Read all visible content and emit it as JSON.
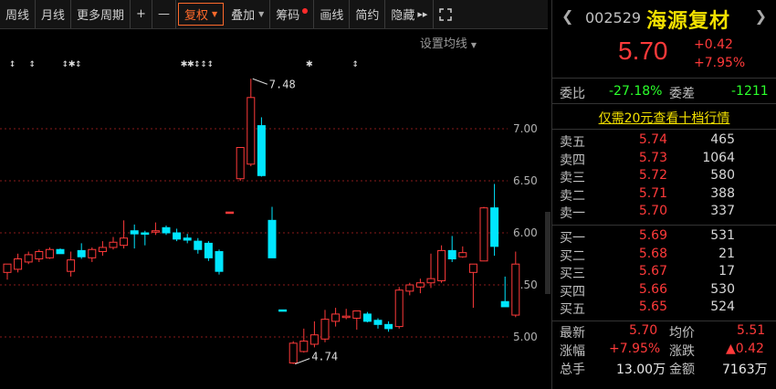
{
  "toolbar": {
    "items": [
      {
        "label": "周线",
        "dropdown": false
      },
      {
        "label": "月线",
        "dropdown": false
      },
      {
        "label": "更多周期",
        "dropdown": false
      },
      {
        "label": "+",
        "dropdown": false
      },
      {
        "label": "—",
        "dropdown": false
      },
      {
        "label": "复权",
        "dropdown": true,
        "active": true
      },
      {
        "label": "叠加",
        "dropdown": true
      },
      {
        "label": "筹码",
        "dropdown": false,
        "red_dot": true
      },
      {
        "label": "画线",
        "dropdown": false
      },
      {
        "label": "简约",
        "dropdown": false
      },
      {
        "label": "隐藏",
        "dropdown": false,
        "suffix": "▸▸"
      }
    ],
    "expand_icon": "expand-icon"
  },
  "chart": {
    "ma_setting_label": "设置均线",
    "y_ticks": [
      "7.00",
      "6.50",
      "6.00",
      "5.50",
      "5.00"
    ],
    "high_label": "7.48",
    "low_label": "4.74",
    "colors": {
      "up": "#ff3a3a",
      "down": "#00e6ff",
      "grid": "#8a1a1a",
      "flat": "#00e6ff"
    }
  },
  "chart_data": {
    "type": "candlestick",
    "ylim": [
      4.7,
      7.6
    ],
    "y_ticks": [
      5.0,
      5.5,
      6.0,
      6.5,
      7.0
    ],
    "candles": [
      {
        "o": 5.62,
        "h": 5.7,
        "l": 5.55,
        "c": 5.7
      },
      {
        "o": 5.65,
        "h": 5.8,
        "l": 5.62,
        "c": 5.75
      },
      {
        "o": 5.72,
        "h": 5.82,
        "l": 5.7,
        "c": 5.79
      },
      {
        "o": 5.75,
        "h": 5.84,
        "l": 5.72,
        "c": 5.82
      },
      {
        "o": 5.76,
        "h": 5.86,
        "l": 5.75,
        "c": 5.84
      },
      {
        "o": 5.84,
        "h": 5.85,
        "l": 5.8,
        "c": 5.8
      },
      {
        "o": 5.63,
        "h": 5.82,
        "l": 5.58,
        "c": 5.74
      },
      {
        "o": 5.83,
        "h": 5.9,
        "l": 5.75,
        "c": 5.77
      },
      {
        "o": 5.76,
        "h": 5.86,
        "l": 5.72,
        "c": 5.84
      },
      {
        "o": 5.82,
        "h": 5.92,
        "l": 5.78,
        "c": 5.86
      },
      {
        "o": 5.86,
        "h": 5.96,
        "l": 5.84,
        "c": 5.91
      },
      {
        "o": 5.88,
        "h": 6.12,
        "l": 5.85,
        "c": 5.95
      },
      {
        "o": 6.02,
        "h": 6.08,
        "l": 5.85,
        "c": 5.99
      },
      {
        "o": 6.0,
        "h": 6.02,
        "l": 5.88,
        "c": 5.99
      },
      {
        "o": 6.01,
        "h": 6.1,
        "l": 5.98,
        "c": 6.02
      },
      {
        "o": 6.05,
        "h": 6.07,
        "l": 5.98,
        "c": 6.0
      },
      {
        "o": 6.0,
        "h": 6.04,
        "l": 5.92,
        "c": 5.94
      },
      {
        "o": 5.95,
        "h": 5.99,
        "l": 5.9,
        "c": 5.93
      },
      {
        "o": 5.92,
        "h": 5.95,
        "l": 5.8,
        "c": 5.84
      },
      {
        "o": 5.9,
        "h": 5.92,
        "l": 5.73,
        "c": 5.76
      },
      {
        "o": 5.82,
        "h": 5.84,
        "l": 5.6,
        "c": 5.63
      },
      {
        "o": 6.2,
        "h": 6.2,
        "l": 6.2,
        "c": 6.2
      },
      {
        "o": 6.52,
        "h": 6.82,
        "l": 6.5,
        "c": 6.82
      },
      {
        "o": 6.66,
        "h": 7.48,
        "l": 6.64,
        "c": 7.3
      },
      {
        "o": 7.03,
        "h": 7.11,
        "l": 6.54,
        "c": 6.55
      },
      {
        "o": 6.12,
        "h": 6.25,
        "l": 5.76,
        "c": 5.76
      },
      {
        "o": 5.26,
        "h": 5.26,
        "l": 5.26,
        "c": 5.26
      },
      {
        "o": 4.75,
        "h": 4.96,
        "l": 4.74,
        "c": 4.94
      },
      {
        "o": 4.86,
        "h": 5.08,
        "l": 4.85,
        "c": 4.96
      },
      {
        "o": 4.93,
        "h": 5.15,
        "l": 4.9,
        "c": 5.02
      },
      {
        "o": 4.98,
        "h": 5.26,
        "l": 4.95,
        "c": 5.17
      },
      {
        "o": 5.15,
        "h": 5.28,
        "l": 5.1,
        "c": 5.22
      },
      {
        "o": 5.19,
        "h": 5.27,
        "l": 5.17,
        "c": 5.2
      },
      {
        "o": 5.18,
        "h": 5.25,
        "l": 5.07,
        "c": 5.25
      },
      {
        "o": 5.22,
        "h": 5.24,
        "l": 5.14,
        "c": 5.15
      },
      {
        "o": 5.16,
        "h": 5.18,
        "l": 5.08,
        "c": 5.12
      },
      {
        "o": 5.12,
        "h": 5.15,
        "l": 5.05,
        "c": 5.08
      },
      {
        "o": 5.1,
        "h": 5.48,
        "l": 5.08,
        "c": 5.45
      },
      {
        "o": 5.44,
        "h": 5.52,
        "l": 5.4,
        "c": 5.5
      },
      {
        "o": 5.48,
        "h": 5.56,
        "l": 5.42,
        "c": 5.52
      },
      {
        "o": 5.52,
        "h": 5.8,
        "l": 5.47,
        "c": 5.56
      },
      {
        "o": 5.54,
        "h": 5.88,
        "l": 5.52,
        "c": 5.83
      },
      {
        "o": 5.83,
        "h": 5.97,
        "l": 5.72,
        "c": 5.75
      },
      {
        "o": 5.77,
        "h": 5.87,
        "l": 5.76,
        "c": 5.81
      },
      {
        "o": 5.62,
        "h": 5.7,
        "l": 5.28,
        "c": 5.7
      },
      {
        "o": 5.73,
        "h": 6.25,
        "l": 5.73,
        "c": 6.24
      },
      {
        "o": 6.24,
        "h": 6.47,
        "l": 5.78,
        "c": 5.87
      },
      {
        "o": 5.34,
        "h": 5.58,
        "l": 5.3,
        "c": 5.29
      },
      {
        "o": 5.21,
        "h": 5.82,
        "l": 5.19,
        "c": 5.7
      }
    ],
    "markers_row": "↕ ↕  ↕✱↕  ✱✱↕↕↕  ✱ ↕"
  },
  "quote": {
    "code": "002529",
    "name": "海源复材",
    "price": "5.70",
    "change": "+0.42",
    "change_pct": "+7.95%",
    "commission_ratio_label": "委比",
    "commission_ratio": "-27.18%",
    "commission_diff_label": "委差",
    "commission_diff": "-1211",
    "promo": "仅需20元查看十档行情",
    "asks": [
      {
        "label": "卖五",
        "price": "5.74",
        "vol": "465"
      },
      {
        "label": "卖四",
        "price": "5.73",
        "vol": "1064"
      },
      {
        "label": "卖三",
        "price": "5.72",
        "vol": "580"
      },
      {
        "label": "卖二",
        "price": "5.71",
        "vol": "388"
      },
      {
        "label": "卖一",
        "price": "5.70",
        "vol": "337"
      }
    ],
    "bids": [
      {
        "label": "买一",
        "price": "5.69",
        "vol": "531"
      },
      {
        "label": "买二",
        "price": "5.68",
        "vol": "21"
      },
      {
        "label": "买三",
        "price": "5.67",
        "vol": "17"
      },
      {
        "label": "买四",
        "price": "5.66",
        "vol": "530"
      },
      {
        "label": "买五",
        "price": "5.65",
        "vol": "524"
      }
    ],
    "stats": {
      "latest_label": "最新",
      "latest": "5.70",
      "avg_label": "均价",
      "avg": "5.51",
      "pct_label": "涨幅",
      "pct": "+7.95%",
      "chg_label": "涨跌",
      "chg": "▲0.42",
      "vol_label": "总手",
      "vol": "13.00万",
      "amount_label": "金额",
      "amount": "7163万"
    }
  }
}
